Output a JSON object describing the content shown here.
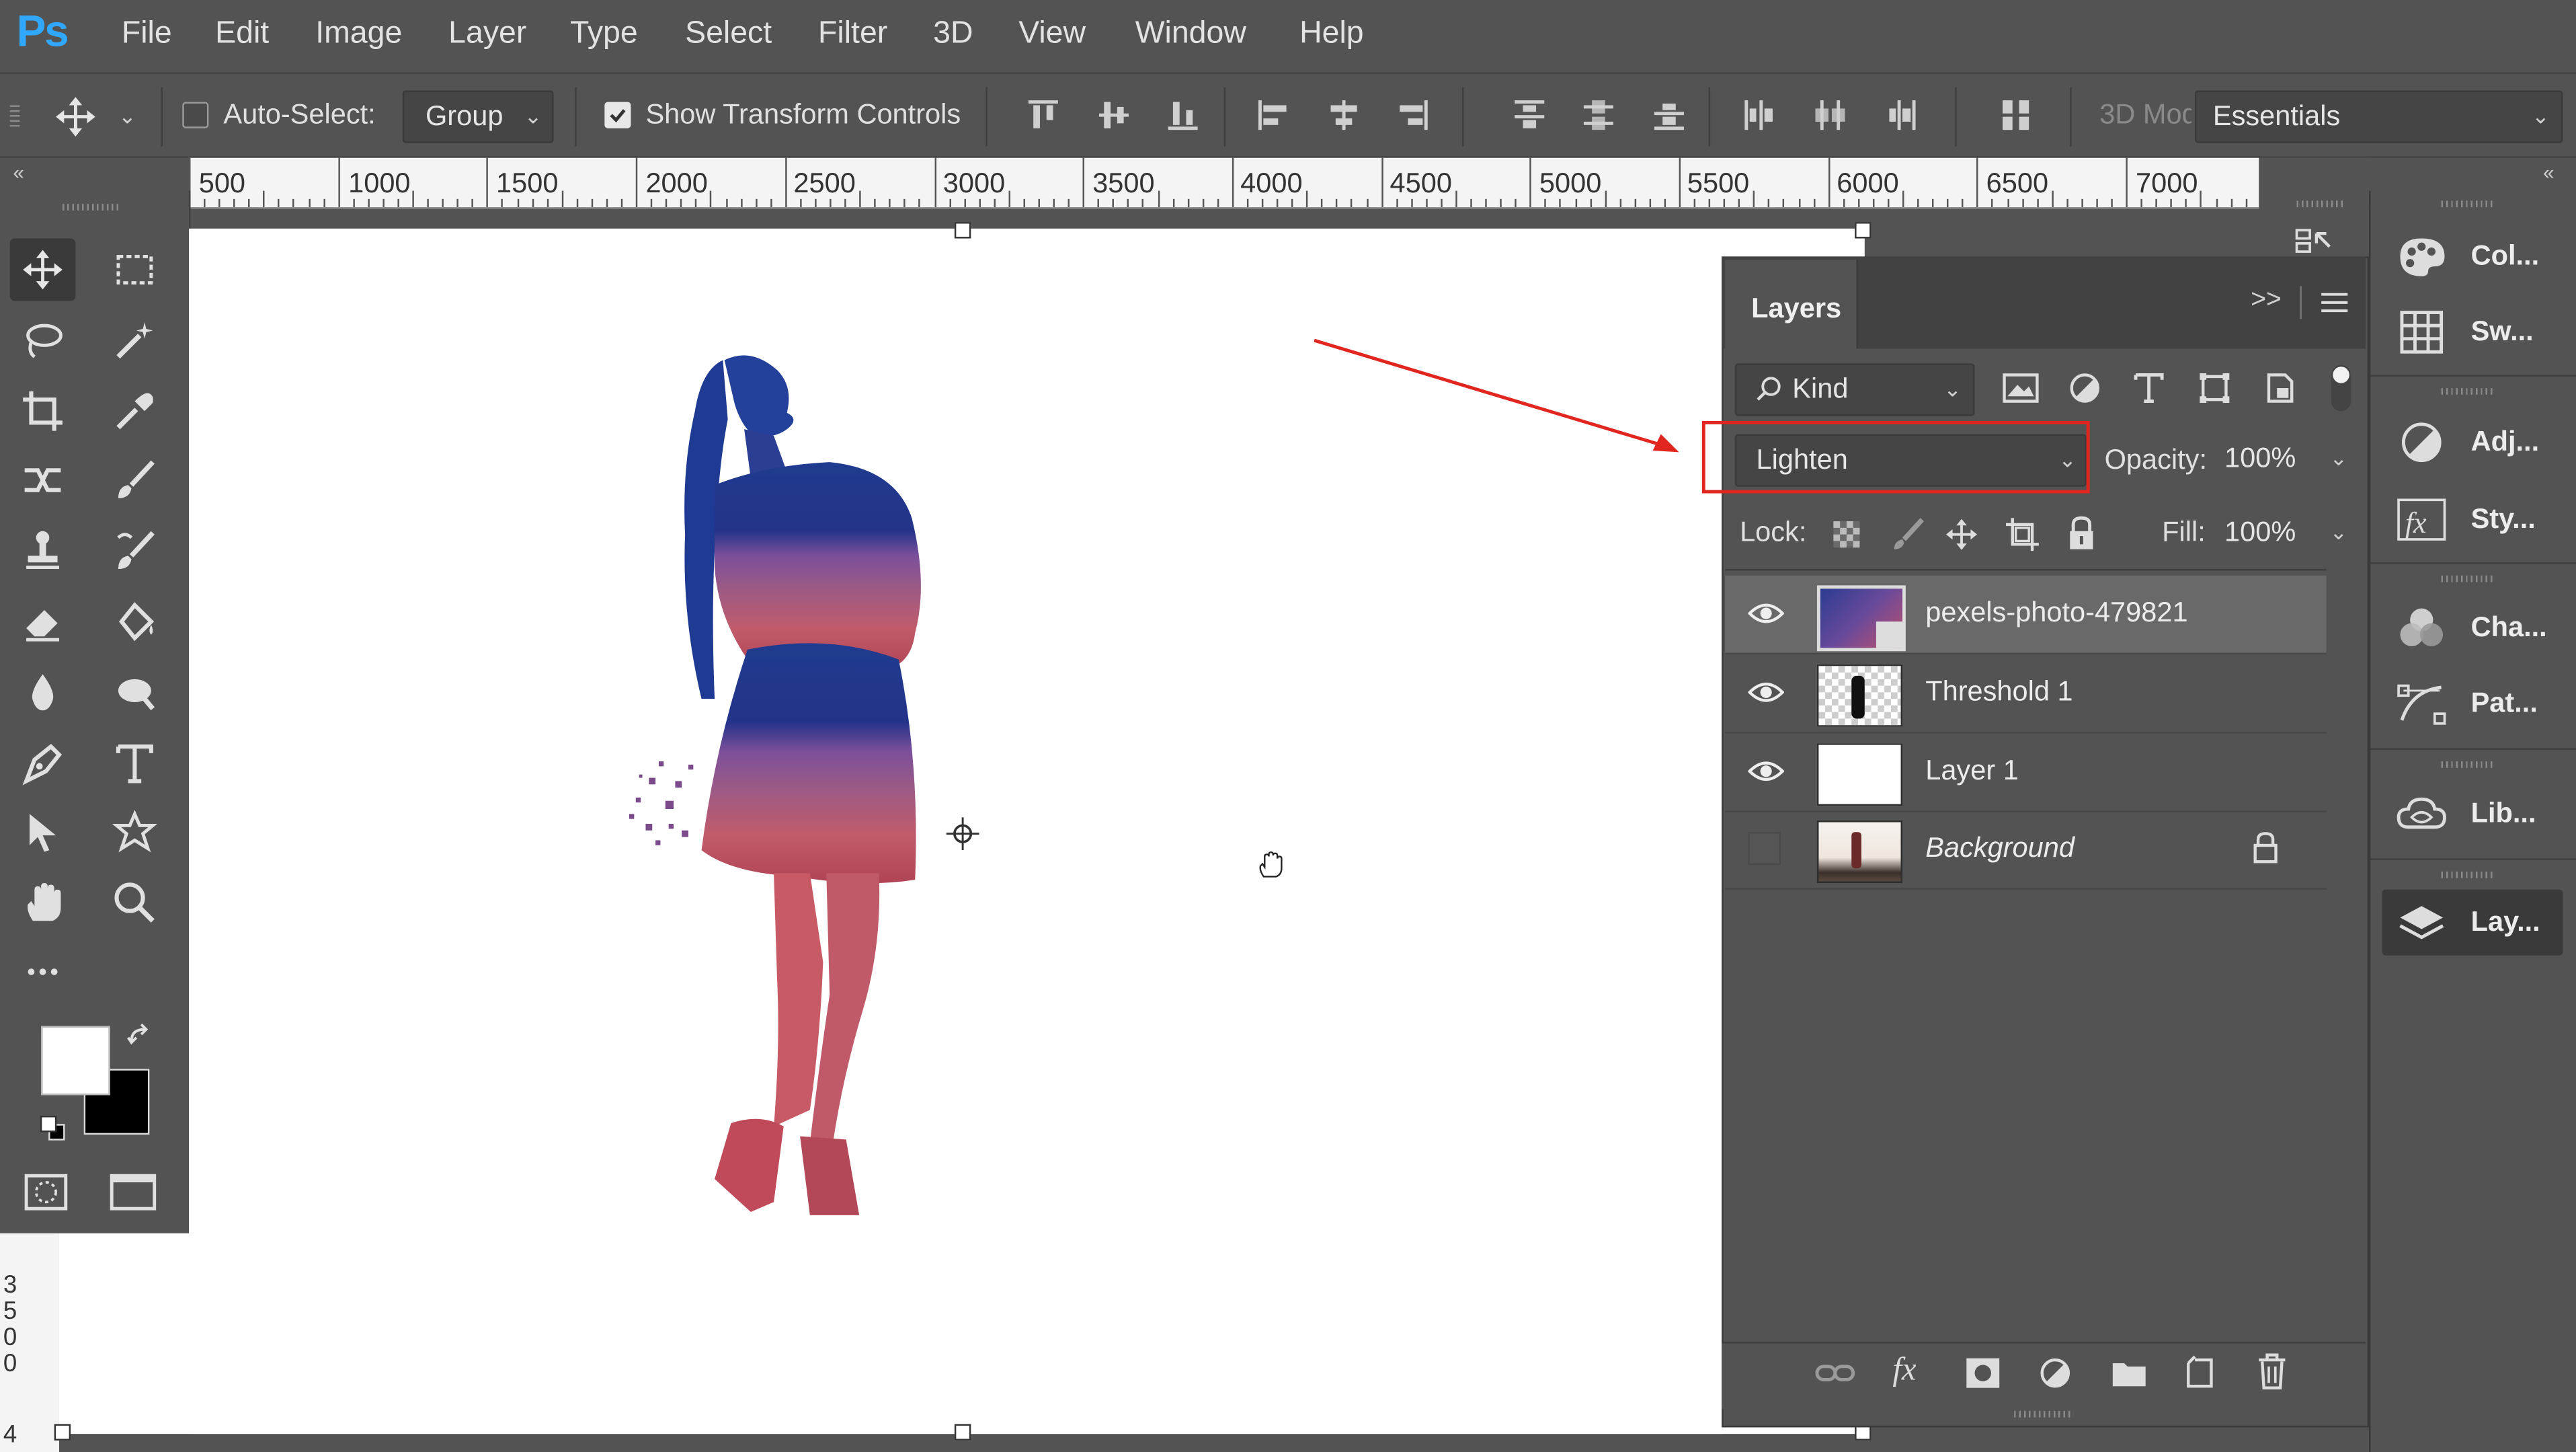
{
  "app": {
    "logo": "Ps"
  },
  "menubar": {
    "items": [
      "File",
      "Edit",
      "Image",
      "Layer",
      "Type",
      "Select",
      "Filter",
      "3D",
      "View",
      "Window",
      "Help"
    ]
  },
  "options_bar": {
    "auto_select_label": "Auto-Select:",
    "auto_select_value": "Group",
    "show_transform_label": "Show Transform Controls",
    "mode_3d_label": "3D Mod",
    "workspace": "Essentials"
  },
  "ruler": {
    "labels": [
      "500",
      "1000",
      "1500",
      "2000",
      "2500",
      "3000",
      "3500",
      "4000",
      "4500",
      "5000",
      "5500",
      "6000",
      "6500",
      "7000"
    ]
  },
  "vertical_ruler": {
    "label": "3 5 0 0"
  },
  "vertical_ruler_bottom": "4",
  "layers_panel": {
    "title": "Layers",
    "filter_kind": "Kind",
    "blend_mode": "Lighten",
    "opacity_label": "Opacity:",
    "opacity_value": "100%",
    "lock_label": "Lock:",
    "fill_label": "Fill:",
    "fill_value": "100%",
    "layers": [
      {
        "name": "pexels-photo-479821",
        "visible": true,
        "selected": true
      },
      {
        "name": "Threshold 1",
        "visible": true,
        "selected": false
      },
      {
        "name": "Layer 1",
        "visible": true,
        "selected": false
      },
      {
        "name": "Background",
        "visible": false,
        "selected": false,
        "locked": true
      }
    ]
  },
  "dock": {
    "items": [
      {
        "label": "Col...",
        "icon": "color-palette-icon"
      },
      {
        "label": "Sw...",
        "icon": "swatches-grid-icon"
      },
      {
        "label": "Adj...",
        "icon": "adjustments-icon"
      },
      {
        "label": "Sty...",
        "icon": "styles-fx-icon"
      },
      {
        "label": "Cha...",
        "icon": "channels-icon"
      },
      {
        "label": "Pat...",
        "icon": "paths-icon"
      },
      {
        "label": "Lib...",
        "icon": "libraries-cloud-icon"
      },
      {
        "label": "Lay...",
        "icon": "layers-stack-icon"
      }
    ]
  },
  "colors": {
    "annotation": "#e0261f",
    "ps_blue": "#31a8ff"
  }
}
